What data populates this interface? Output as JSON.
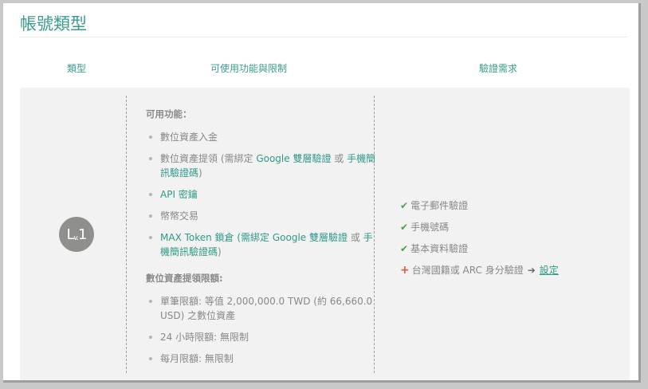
{
  "page_title": "帳號類型",
  "columns": {
    "type": "類型",
    "features": "可使用功能與限制",
    "requirements": "驗證需求"
  },
  "level": {
    "badge_main": "L",
    "badge_sub": "v.",
    "badge_num": "1"
  },
  "features": {
    "title": "可用功能：",
    "items": [
      {
        "pre": "數位資產入金"
      },
      {
        "pre": "數位資產提領 (需綁定 ",
        "link1": "Google 雙層驗證",
        "mid": " 或 ",
        "link2": "手機簡訊驗證碼",
        "post": ")"
      },
      {
        "pre": "API 密鑰"
      },
      {
        "pre": "幣幣交易"
      },
      {
        "pre": "MAX Token 鎖倉 (需綁定 ",
        "link1": "Google 雙層驗證",
        "mid": " 或 ",
        "link2": "手機簡訊驗證碼",
        "post": ")"
      }
    ]
  },
  "limits": {
    "title": "數位資產提領限額:",
    "items": [
      "單筆限額: 等值 2,000,000.0 TWD (約 66,660.0 USD) 之數位資產",
      "24 小時限額: 無限制",
      "每月限額: 無限制"
    ]
  },
  "requirements": {
    "completed": [
      "電子郵件驗證",
      "手機號碼",
      "基本資料驗證"
    ],
    "pending": "台灣國籍或 ARC 身分驗證",
    "action_link": "設定"
  },
  "colors": {
    "accent": "#3a9c8c",
    "check": "#4aa34a",
    "pending": "#e05a3a"
  }
}
